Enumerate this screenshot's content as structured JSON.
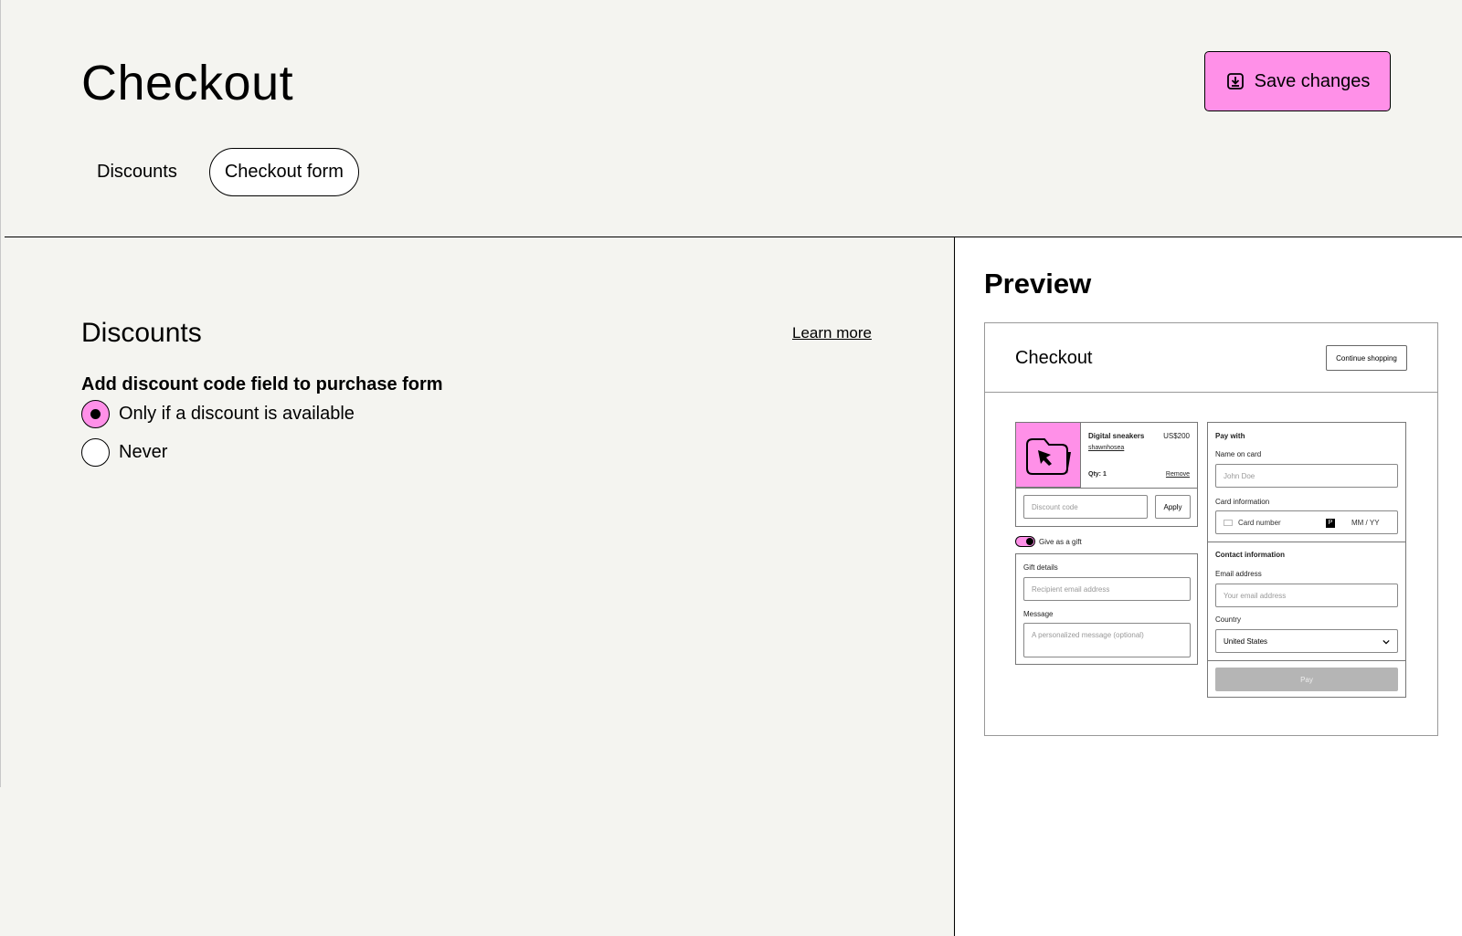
{
  "header": {
    "title": "Checkout",
    "save_label": "Save changes",
    "tabs": [
      {
        "label": "Discounts",
        "active": false
      },
      {
        "label": "Checkout form",
        "active": true
      }
    ]
  },
  "discounts": {
    "title": "Discounts",
    "learn_more": "Learn more",
    "field_label": "Add discount code field to purchase form",
    "options": [
      {
        "label": "Only if a discount is available",
        "selected": true
      },
      {
        "label": "Never",
        "selected": false
      }
    ]
  },
  "preview": {
    "title": "Preview",
    "checkout_title": "Checkout",
    "continue_shopping": "Continue shopping",
    "product": {
      "name": "Digital sneakers",
      "price": "US$200",
      "seller": "shawnhosea",
      "qty": "Qty: 1",
      "remove": "Remove"
    },
    "discount_placeholder": "Discount code",
    "apply": "Apply",
    "gift_toggle": "Give as a gift",
    "gift_details": "Gift details",
    "recipient_placeholder": "Recipient email address",
    "message_label": "Message",
    "message_placeholder": "A personalized message (optional)",
    "pay_with": "Pay with",
    "name_on_card": "Name on card",
    "name_placeholder": "John Doe",
    "card_info": "Card information",
    "card_number": "Card number",
    "card_badge": "P",
    "expiry": "MM / YY",
    "contact_info": "Contact information",
    "email_label": "Email address",
    "email_placeholder": "Your email address",
    "country_label": "Country",
    "country_value": "United States",
    "pay": "Pay"
  },
  "colors": {
    "accent": "#ff90e8",
    "background": "#f4f4f0"
  }
}
